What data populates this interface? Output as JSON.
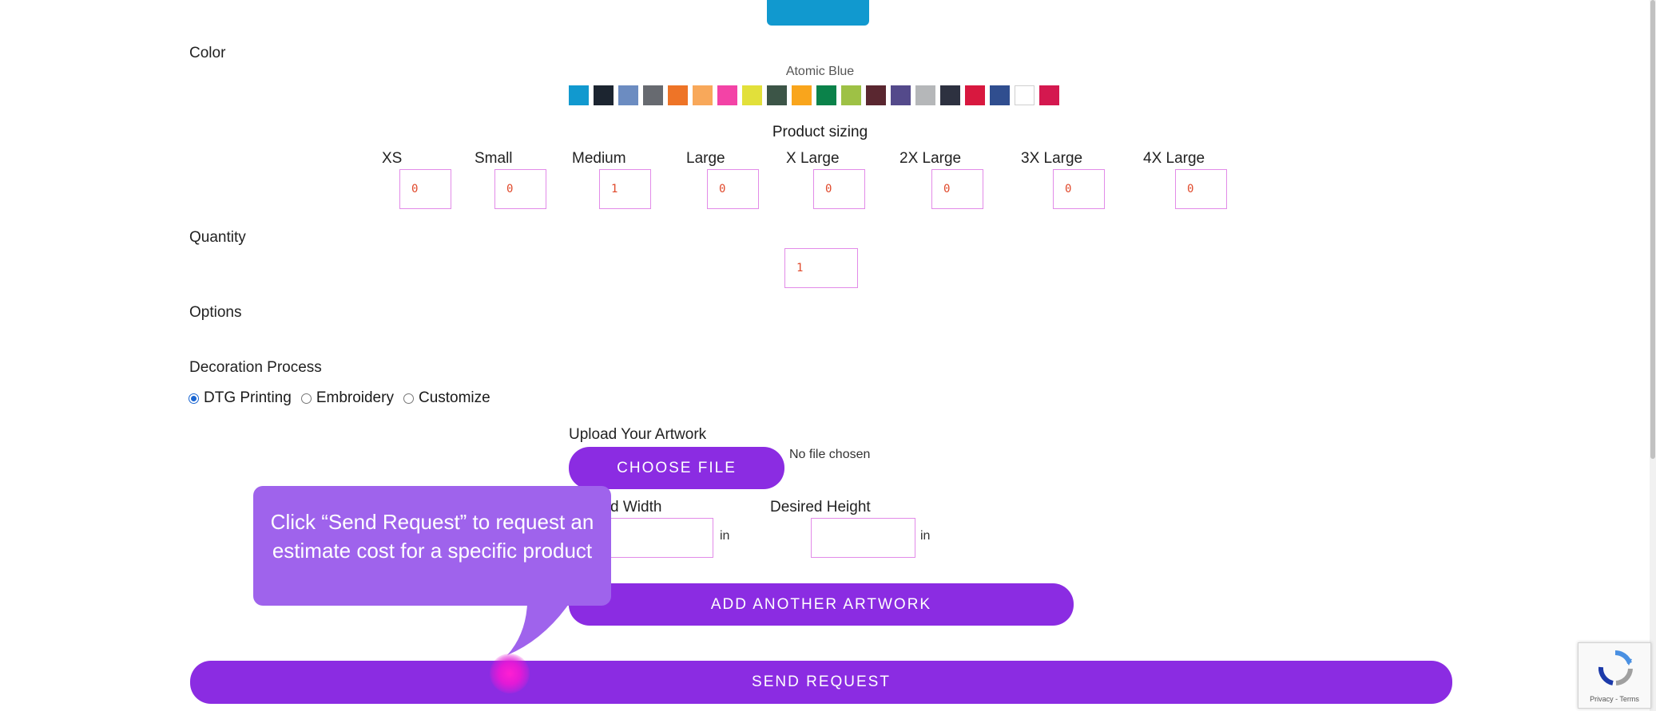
{
  "form": {
    "color": {
      "label": "Color",
      "selected_name": "Atomic Blue",
      "swatches": [
        "#1199cf",
        "#1c2530",
        "#6c8cc1",
        "#676a70",
        "#ee7427",
        "#f8a85a",
        "#f343a6",
        "#e2e03a",
        "#3c5547",
        "#f9a51c",
        "#0b824a",
        "#9ec145",
        "#5a2730",
        "#544a8b",
        "#b5b7b9",
        "#2d3140",
        "#d8183f",
        "#304e8f",
        "#ffffff",
        "#d4184f"
      ]
    },
    "sizing": {
      "title": "Product sizing",
      "sizes": [
        {
          "label": "XS",
          "value": "0"
        },
        {
          "label": "Small",
          "value": "0"
        },
        {
          "label": "Medium",
          "value": "1"
        },
        {
          "label": "Large",
          "value": "0"
        },
        {
          "label": "X Large",
          "value": "0"
        },
        {
          "label": "2X Large",
          "value": "0"
        },
        {
          "label": "3X Large",
          "value": "0"
        },
        {
          "label": "4X Large",
          "value": "0"
        }
      ]
    },
    "quantity": {
      "label": "Quantity",
      "value": "1"
    },
    "options": {
      "label": "Options"
    },
    "decoration": {
      "label": "Decoration Process",
      "choices": [
        "DTG Printing",
        "Embroidery",
        "Customize"
      ],
      "selected": "DTG Printing"
    },
    "artwork": {
      "upload_label": "Upload Your Artwork",
      "choose_file_label": "CHOOSE FILE",
      "no_file_text": "No file chosen",
      "width_label": "d Width",
      "height_label": "Desired Height",
      "width_value": "",
      "height_value": "",
      "unit": "in",
      "add_another_label": "ADD ANOTHER ARTWORK"
    },
    "send_request_label": "SEND REQUEST"
  },
  "tooltip": {
    "text": "Click “Send Request” to request an estimate cost for a specific product"
  },
  "recaptcha": {
    "footer": "Privacy - Terms"
  },
  "colors": {
    "accent": "#8b2ce2",
    "tooltip": "#9f63ec",
    "input_border": "#e28be8",
    "hotspot": "#e31ad6"
  }
}
